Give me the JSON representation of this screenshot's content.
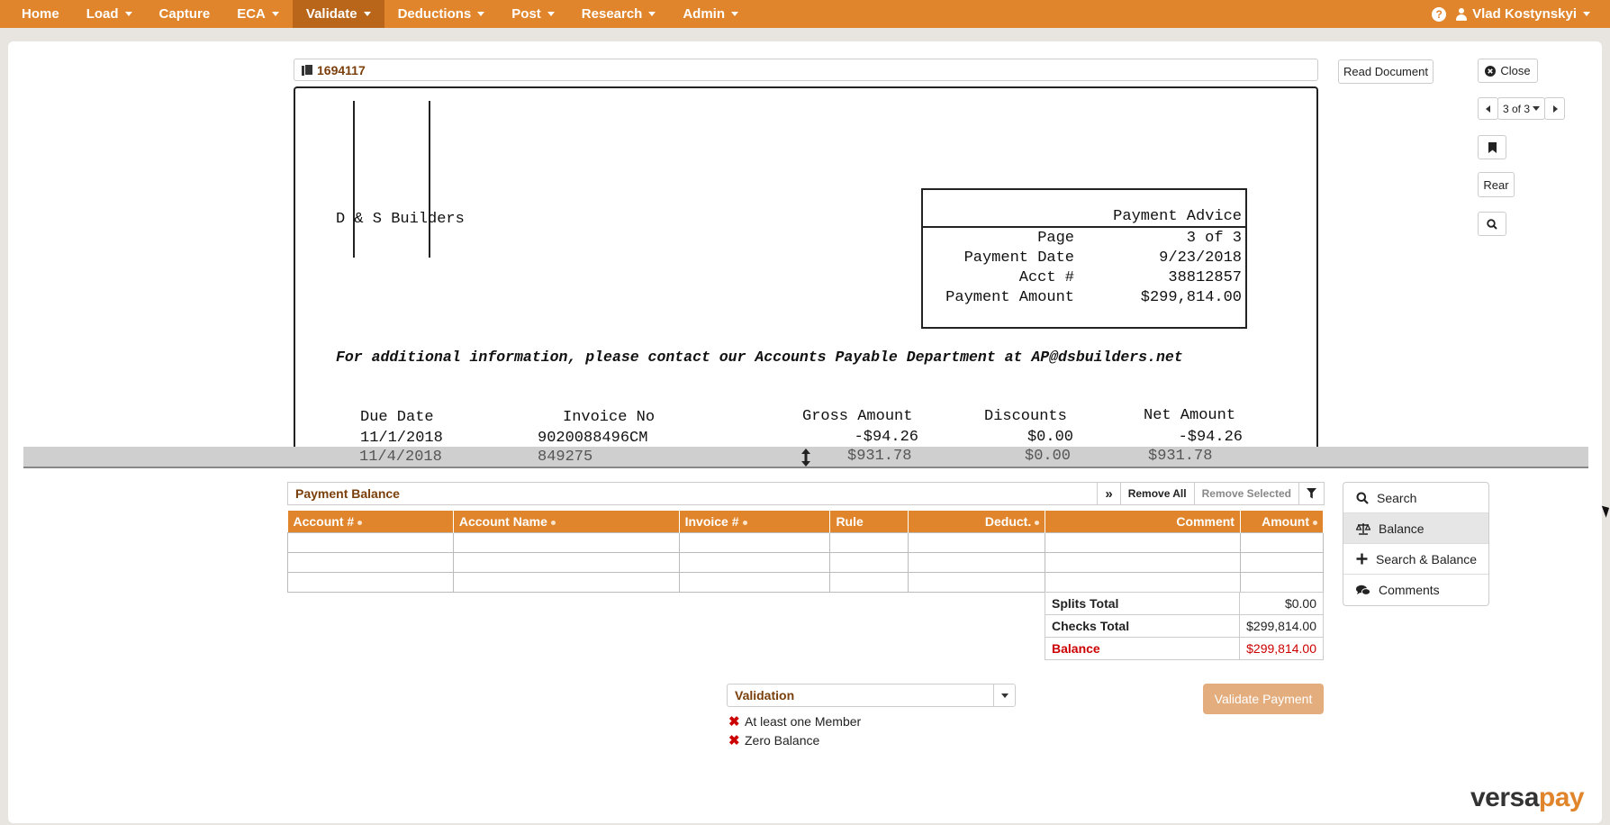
{
  "navbar": {
    "items": [
      {
        "label": "Home",
        "dropdown": false
      },
      {
        "label": "Load",
        "dropdown": true
      },
      {
        "label": "Capture",
        "dropdown": false
      },
      {
        "label": "ECA",
        "dropdown": true
      },
      {
        "label": "Validate",
        "dropdown": true,
        "active": true
      },
      {
        "label": "Deductions",
        "dropdown": true
      },
      {
        "label": "Post",
        "dropdown": true
      },
      {
        "label": "Research",
        "dropdown": true
      },
      {
        "label": "Admin",
        "dropdown": true
      }
    ],
    "help_icon": "?",
    "user_name": "Vlad Kostynskyi"
  },
  "document": {
    "id": "1694117",
    "read_button": "Read Document",
    "close_button": "Close",
    "pager": "3 of 3",
    "rear_button": "Rear",
    "image": {
      "company": "D & S Builders",
      "advice_title": "Payment Advice",
      "advice_rows": [
        {
          "label": "Page",
          "value": "3 of 3"
        },
        {
          "label": "Payment Date",
          "value": "9/23/2018"
        },
        {
          "label": "Acct #",
          "value": "38812857"
        },
        {
          "label": "Payment Amount",
          "value": "$299,814.00"
        }
      ],
      "contact_line": "For additional information, please contact our Accounts Payable Department at AP@dsbuilders.net",
      "columns": [
        "Due Date",
        "Invoice No",
        "Gross Amount",
        "Discounts",
        "Net Amount"
      ],
      "rows": [
        {
          "due": "11/1/2018",
          "invoice": "9020088496CM",
          "gross": "-$94.26",
          "disc": "$0.00",
          "net": "-$94.26"
        },
        {
          "due": "11/4/2018",
          "invoice": "849275",
          "gross": "$931.78",
          "disc": "$0.00",
          "net": "$931.78"
        }
      ]
    }
  },
  "payment_balance": {
    "title": "Payment Balance",
    "expand_label": "»",
    "remove_all": "Remove All",
    "remove_selected": "Remove Selected",
    "columns": [
      "Account #",
      "Account Name",
      "Invoice #",
      "Rule",
      "Deduct.",
      "Comment",
      "Amount"
    ],
    "totals": [
      {
        "label": "Splits Total",
        "value": "$0.00"
      },
      {
        "label": "Checks Total",
        "value": "$299,814.00"
      },
      {
        "label": "Balance",
        "value": "$299,814.00"
      }
    ]
  },
  "side_menu": {
    "items": [
      {
        "label": "Search",
        "icon": "search-icon"
      },
      {
        "label": "Balance",
        "icon": "scale-icon",
        "active": true
      },
      {
        "label": "Search & Balance",
        "icon": "plus-icon"
      },
      {
        "label": "Comments",
        "icon": "comments-icon"
      }
    ]
  },
  "validation": {
    "label": "Validation",
    "items": [
      "At least one Member",
      "Zero Balance"
    ],
    "button": "Validate Payment"
  },
  "brand": {
    "logo_main": "versa",
    "logo_accent": "pay",
    "accent_color": "#e0852b",
    "error_color": "#cc0000"
  }
}
